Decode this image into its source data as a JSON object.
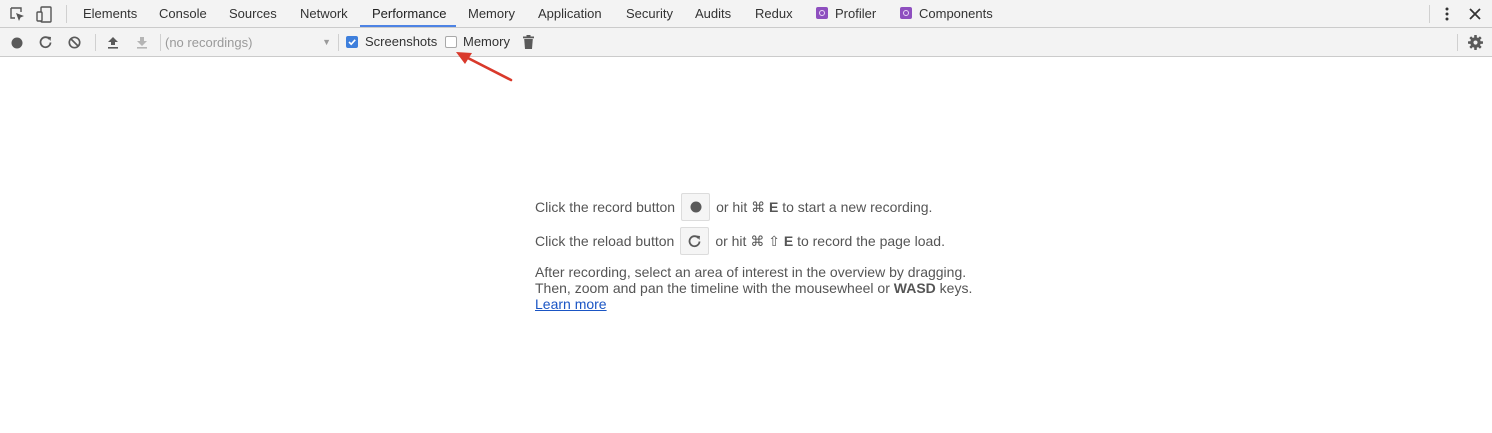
{
  "tabbar": {
    "tabs": [
      {
        "label": "Elements"
      },
      {
        "label": "Console"
      },
      {
        "label": "Sources"
      },
      {
        "label": "Network"
      },
      {
        "label": "Performance",
        "active": true
      },
      {
        "label": "Memory"
      },
      {
        "label": "Application"
      },
      {
        "label": "Security"
      },
      {
        "label": "Audits"
      },
      {
        "label": "Redux"
      },
      {
        "label": "Profiler",
        "icon": "react-icon"
      },
      {
        "label": "Components",
        "icon": "react-icon"
      }
    ],
    "active_color": "#4d83e4"
  },
  "toolbar": {
    "recording_select": "(no recordings)",
    "screenshots_label": "Screenshots",
    "screenshots_checked": true,
    "memory_label": "Memory",
    "memory_checked": false
  },
  "landing": {
    "record_prefix": "Click the record button",
    "record_mid": "or hit",
    "record_key_cmd": "⌘",
    "record_key": "E",
    "record_suffix": "to start a new recording.",
    "reload_prefix": "Click the reload button",
    "reload_mid": "or hit",
    "reload_key_cmd": "⌘",
    "reload_key_shift": "⇧",
    "reload_key": "E",
    "reload_suffix": "to record the page load.",
    "after_line1": "After recording, select an area of interest in the overview by dragging.",
    "after_line2_prefix": "Then, zoom and pan the timeline with the mousewheel or",
    "after_line2_keys": "WASD",
    "after_line2_suffix": "keys.",
    "learn_more": "Learn more"
  },
  "annotation": {
    "arrow_color": "#d9392b"
  }
}
